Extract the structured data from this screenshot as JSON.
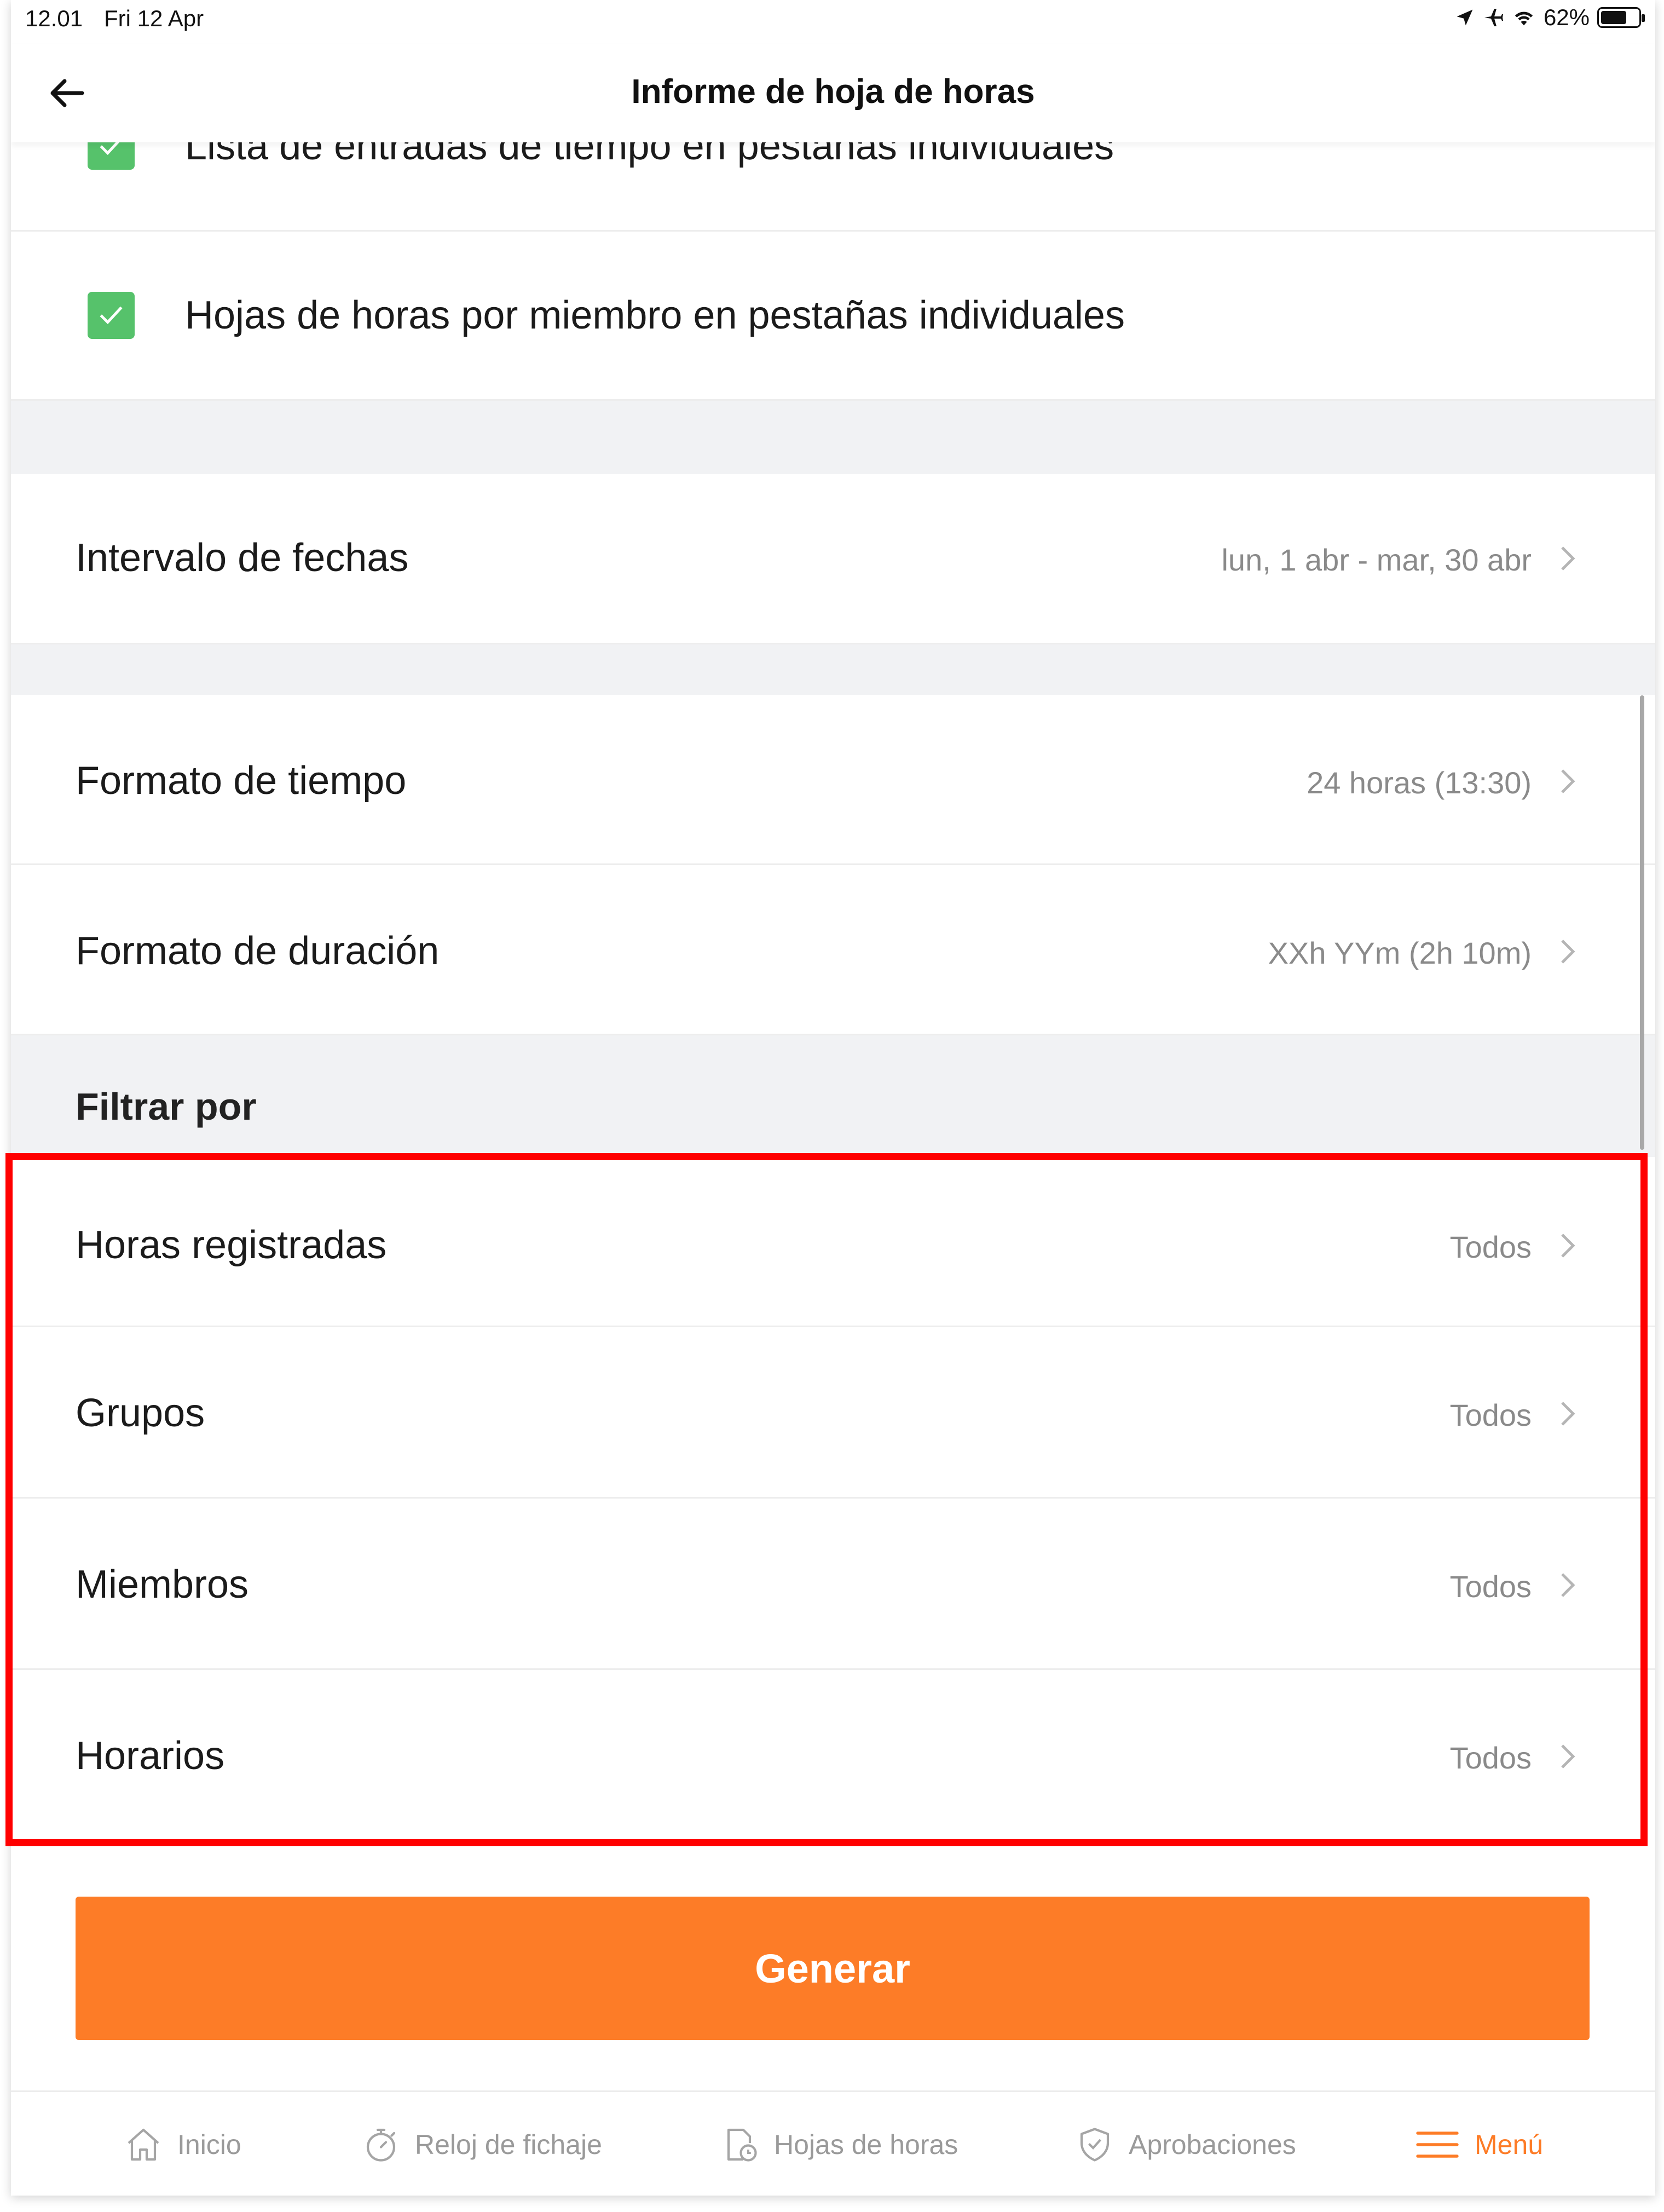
{
  "status_bar": {
    "time": "12.01",
    "date": "Fri 12 Apr",
    "battery": "62%",
    "battery_level": 0.62
  },
  "header": {
    "title": "Informe de hoja de horas"
  },
  "checkboxes": [
    {
      "label": "Lista de entradas de tiempo en pestañas individuales",
      "checked": true
    },
    {
      "label": "Hojas de horas por miembro en pestañas individuales",
      "checked": true
    }
  ],
  "settings": [
    {
      "label": "Intervalo de fechas",
      "value": "lun, 1 abr - mar, 30 abr"
    },
    {
      "label": "Formato de tiempo",
      "value": "24 horas (13:30)"
    },
    {
      "label": "Formato de duración",
      "value": "XXh YYm (2h 10m)"
    }
  ],
  "filter": {
    "heading": "Filtrar por",
    "items": [
      {
        "label": "Horas registradas",
        "value": "Todos"
      },
      {
        "label": "Grupos",
        "value": "Todos"
      },
      {
        "label": "Miembros",
        "value": "Todos"
      },
      {
        "label": "Horarios",
        "value": "Todos"
      }
    ]
  },
  "generate_label": "Generar",
  "tabs": [
    {
      "label": "Inicio",
      "icon": "home-icon",
      "active": false
    },
    {
      "label": "Reloj de fichaje",
      "icon": "stopwatch-icon",
      "active": false
    },
    {
      "label": "Hojas de horas",
      "icon": "timesheet-icon",
      "active": false
    },
    {
      "label": "Aprobaciones",
      "icon": "shield-check-icon",
      "active": false
    },
    {
      "label": "Menú",
      "icon": "hamburger-menu-icon",
      "active": true
    }
  ],
  "colors": {
    "accent": "#fd7c27",
    "check": "#56c26b",
    "highlight": "#ff0000"
  }
}
